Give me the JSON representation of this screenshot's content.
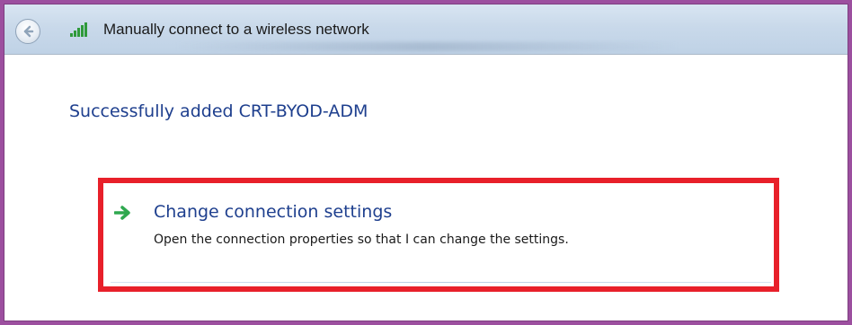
{
  "titlebar": {
    "title": "Manually connect to a wireless network",
    "back_icon": "back-arrow-icon",
    "network_icon": "wireless-signal-icon"
  },
  "main": {
    "heading": "Successfully added CRT-BYOD-ADM"
  },
  "task": {
    "title": "Change connection settings",
    "description": "Open the connection properties so that I can change the settings.",
    "icon": "green-arrow-icon"
  },
  "colors": {
    "heading": "#1e3f8e",
    "highlight": "#e8202a",
    "arrow": "#2fa84f",
    "frame": "#9c4f9f"
  }
}
